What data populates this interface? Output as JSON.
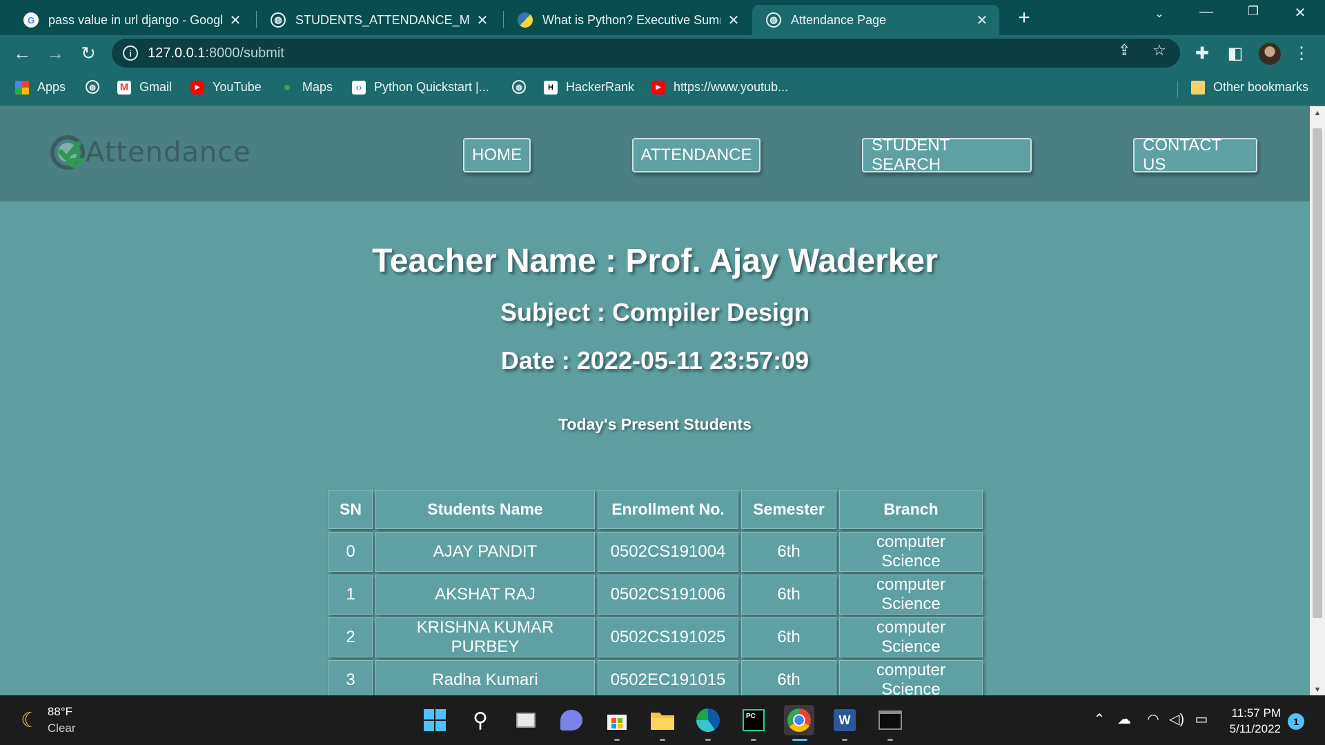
{
  "browser": {
    "tabs": [
      {
        "title": "pass value in url django - Google",
        "favicon": "google-icon",
        "active": false
      },
      {
        "title": "STUDENTS_ATTENDANCE_MANA",
        "favicon": "globe-icon",
        "active": false
      },
      {
        "title": "What is Python? Executive Summ",
        "favicon": "python-icon",
        "active": false
      },
      {
        "title": "Attendance Page",
        "favicon": "globe-icon",
        "active": true
      }
    ],
    "url_host": "127.0.0.1",
    "url_path": ":8000/submit",
    "bookmarks": [
      {
        "label": "Apps",
        "icon": "apps-grid-icon"
      },
      {
        "label": "",
        "icon": "globe-icon"
      },
      {
        "label": "Gmail",
        "icon": "gmail-icon"
      },
      {
        "label": "YouTube",
        "icon": "youtube-icon"
      },
      {
        "label": "Maps",
        "icon": "maps-icon"
      },
      {
        "label": "Python Quickstart |...",
        "icon": "python-quickstart-icon"
      },
      {
        "label": "",
        "icon": "globe-icon"
      },
      {
        "label": "HackerRank",
        "icon": "hackerrank-icon"
      },
      {
        "label": "https://www.youtub...",
        "icon": "youtube-icon"
      }
    ],
    "other_bookmarks": "Other bookmarks"
  },
  "site": {
    "logo_text": "Attendance",
    "nav": [
      "HOME",
      "ATTENDANCE",
      "STUDENT SEARCH",
      "CONTACT US"
    ]
  },
  "content": {
    "teacher_line": "Teacher Name : Prof. Ajay Waderker",
    "subject_line": "Subject : Compiler Design",
    "date_line": "Date : 2022-05-11 23:57:09",
    "table_caption": "Today's Present Students",
    "columns": [
      "SN",
      "Students Name",
      "Enrollment No.",
      "Semester",
      "Branch"
    ],
    "rows": [
      [
        "0",
        "AJAY PANDIT",
        "0502CS191004",
        "6th",
        "computer Science"
      ],
      [
        "1",
        "AKSHAT RAJ",
        "0502CS191006",
        "6th",
        "computer Science"
      ],
      [
        "2",
        "KRISHNA KUMAR PURBEY",
        "0502CS191025",
        "6th",
        "computer Science"
      ],
      [
        "3",
        "Radha Kumari",
        "0502EC191015",
        "6th",
        "computer Science"
      ]
    ]
  },
  "taskbar": {
    "weather_temp": "88°F",
    "weather_desc": "Clear",
    "time": "11:57 PM",
    "date": "5/11/2022",
    "notifications": "1"
  }
}
